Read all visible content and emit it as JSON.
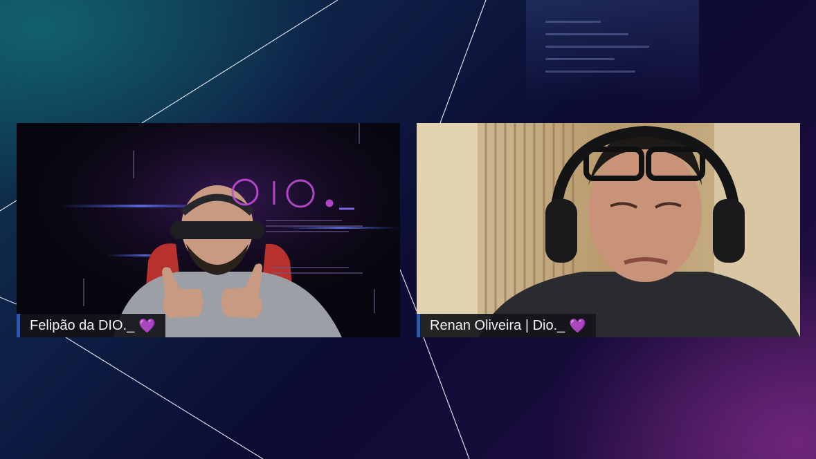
{
  "participants": [
    {
      "name": "Felipão da DIO._",
      "badge": "💜"
    },
    {
      "name": "Renan Oliveira | Dio._",
      "badge": "💜"
    }
  ],
  "left_tile": {
    "wallpaper_logo": "dio._"
  },
  "colors": {
    "background_dark": "#0c0b33",
    "background_teal": "#0d3a52",
    "background_purple": "#3a1450",
    "nameplate_bg": "#14141a",
    "nameplate_accent": "#2f57a8",
    "heart": "#a452e6",
    "logo_glow": "#c24bd8"
  }
}
